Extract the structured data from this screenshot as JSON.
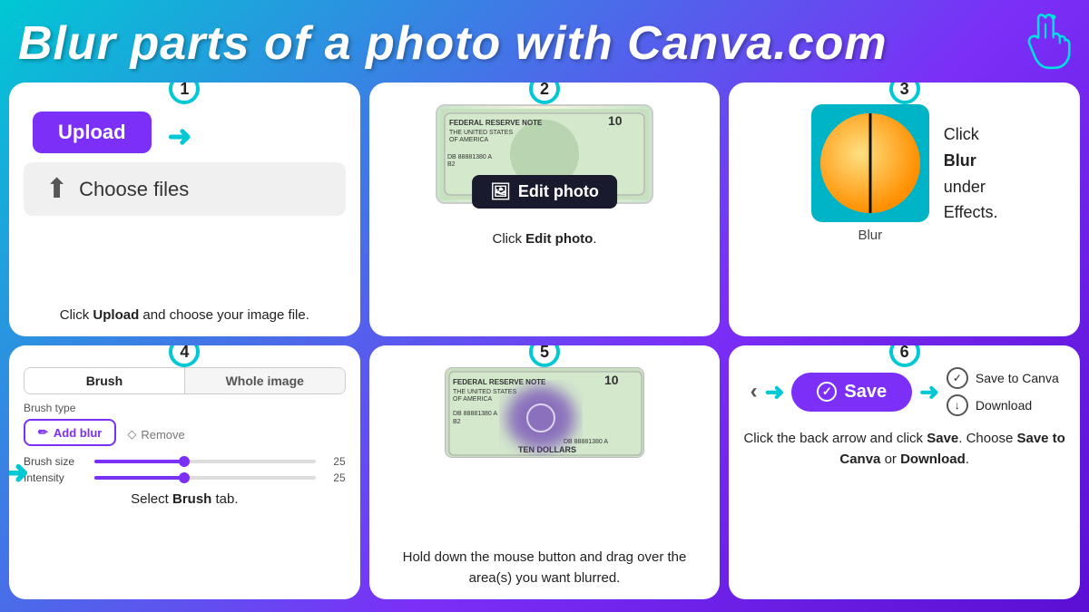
{
  "header": {
    "title": "Blur parts of a photo with Canva.com"
  },
  "steps": [
    {
      "number": "1",
      "upload_label": "Upload",
      "choose_files": "Choose files",
      "desc_plain": "Click ",
      "desc_bold": "Upload",
      "desc_end": " and choose your image file."
    },
    {
      "number": "2",
      "edit_photo": "Edit photo",
      "desc_plain": "Click ",
      "desc_bold": "Edit photo",
      "desc_end": "."
    },
    {
      "number": "3",
      "blur_label": "Blur",
      "desc": "Click ",
      "desc_bold": "Blur",
      "desc_mid": " under Effects.",
      "click_text_1": "Click",
      "click_bold": "Blur",
      "click_text_2": "under",
      "click_text_3": "Effects."
    },
    {
      "number": "4",
      "tab_brush": "Brush",
      "tab_whole": "Whole image",
      "brush_type": "Brush type",
      "add_blur": "Add blur",
      "remove": "Remove",
      "brush_size": "Brush size",
      "brush_size_val": "25",
      "intensity": "Intensity",
      "intensity_val": "25",
      "desc_plain": "Select ",
      "desc_bold": "Brush",
      "desc_end": " tab."
    },
    {
      "number": "5",
      "desc": "Hold down the mouse button and drag over the area(s) you want blurred."
    },
    {
      "number": "6",
      "save_label": "Save",
      "option1": "Save to Canva",
      "option2": "Download",
      "desc": "Click the back arrow and click ",
      "desc_bold1": "Save",
      "desc_mid": ". Choose ",
      "desc_bold2": "Save to Canva",
      "desc_mid2": " or ",
      "desc_bold3": "Download",
      "desc_end": "."
    }
  ]
}
